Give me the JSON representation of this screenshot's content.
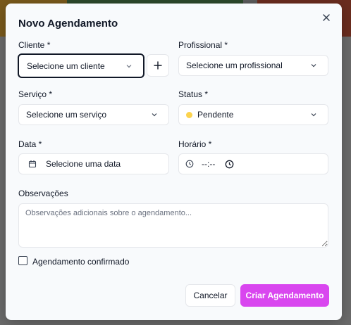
{
  "colors": {
    "backdrop": "#6b6b6b",
    "strip": [
      "#7a5a1c",
      "#2e4a2c",
      "#5d5d5d",
      "#6b2d1f"
    ],
    "accent": "#d946ef",
    "status_pending": "#fcd34d"
  },
  "dialog": {
    "title": "Novo Agendamento",
    "close_icon": "close-icon"
  },
  "form": {
    "cliente": {
      "label": "Cliente *",
      "placeholder": "Selecione um cliente",
      "add_icon": "plus-icon"
    },
    "profissional": {
      "label": "Profissional *",
      "placeholder": "Selecione um profissional"
    },
    "servico": {
      "label": "Serviço *",
      "placeholder": "Selecione um serviço"
    },
    "status": {
      "label": "Status *",
      "value": "Pendente"
    },
    "data": {
      "label": "Data *",
      "placeholder": "Selecione uma data",
      "icon": "calendar-icon"
    },
    "horario": {
      "label": "Horário *",
      "value": "--:--",
      "icon": "clock-icon"
    },
    "observacoes": {
      "label": "Observações",
      "placeholder": "Observações adicionais sobre o agendamento..."
    },
    "confirmado": {
      "label": "Agendamento confirmado",
      "checked": false
    }
  },
  "actions": {
    "cancel": "Cancelar",
    "create": "Criar Agendamento"
  }
}
